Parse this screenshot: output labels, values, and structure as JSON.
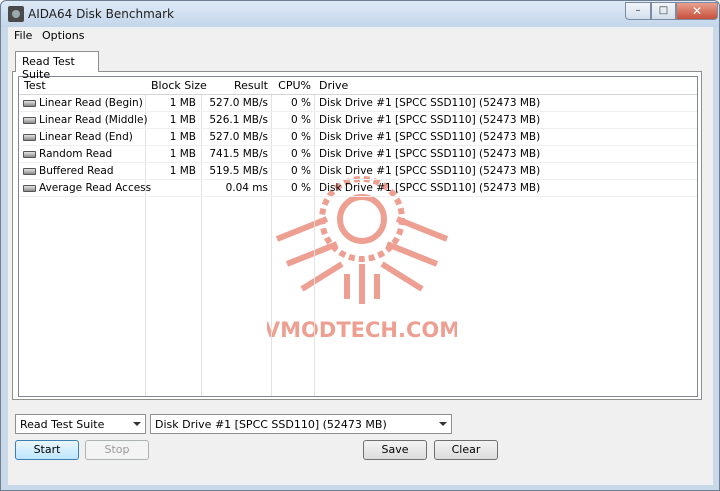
{
  "window": {
    "title": "AIDA64 Disk Benchmark",
    "controls": {
      "minimize": "–",
      "maximize": "□",
      "close": "✕"
    }
  },
  "menu": {
    "file": "File",
    "options": "Options"
  },
  "tab": {
    "label": "Read Test Suite"
  },
  "columns": {
    "test": "Test",
    "block": "Block Size",
    "result": "Result",
    "cpu": "CPU%",
    "drive": "Drive"
  },
  "rows": [
    {
      "test": "Linear Read (Begin)",
      "block": "1 MB",
      "result": "527.0 MB/s",
      "cpu": "0 %",
      "drive": "Disk Drive #1  [SPCC SSD110]  (52473 MB)"
    },
    {
      "test": "Linear Read (Middle)",
      "block": "1 MB",
      "result": "526.1 MB/s",
      "cpu": "0 %",
      "drive": "Disk Drive #1  [SPCC SSD110]  (52473 MB)"
    },
    {
      "test": "Linear Read (End)",
      "block": "1 MB",
      "result": "527.0 MB/s",
      "cpu": "0 %",
      "drive": "Disk Drive #1  [SPCC SSD110]  (52473 MB)"
    },
    {
      "test": "Random Read",
      "block": "1 MB",
      "result": "741.5 MB/s",
      "cpu": "0 %",
      "drive": "Disk Drive #1  [SPCC SSD110]  (52473 MB)"
    },
    {
      "test": "Buffered Read",
      "block": "1 MB",
      "result": "519.5 MB/s",
      "cpu": "0 %",
      "drive": "Disk Drive #1  [SPCC SSD110]  (52473 MB)"
    },
    {
      "test": "Average Read Access",
      "block": "",
      "result": "0.04 ms",
      "cpu": "0 %",
      "drive": "Disk Drive #1  [SPCC SSD110]  (52473 MB)"
    }
  ],
  "watermark": {
    "text": "VMODTECH.COM",
    "color": "#e0523a"
  },
  "controls": {
    "suite_select": "Read Test Suite",
    "drive_select": "Disk Drive #1  [SPCC SSD110]  (52473 MB)",
    "start": "Start",
    "stop": "Stop",
    "save": "Save",
    "clear": "Clear"
  }
}
